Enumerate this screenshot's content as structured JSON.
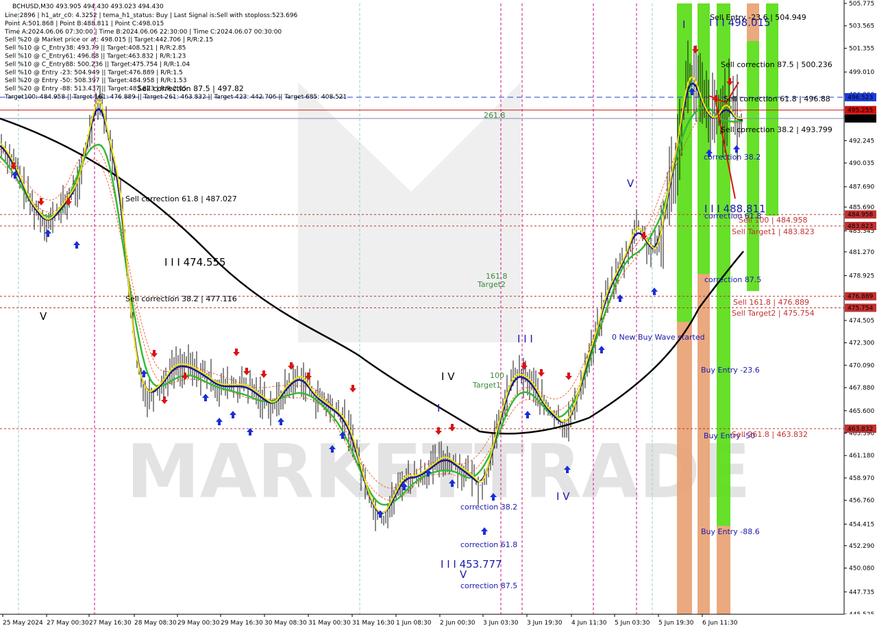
{
  "chart_data": {
    "type": "candlestick",
    "symbol_line": "BCHUSD,M30  493.905 494.430 493.023 494.430",
    "info_lines": [
      "Line:2896 | h1_atr_c0: 4.3252 | tema_h1_status: Buy | Last Signal is:Sell with stoploss:523.696",
      "Point A:501.868 | Point B:488.811 | Point C:498.015",
      "Time A:2024.06.06 07:30:00 | Time B:2024.06.06 22:30:00 | Time C:2024.06.07 00:30:00",
      "Sell %20 @ Market price or at: 498.015 || Target:442.706 | R/R:2.15",
      "Sell %10 @ C_Entry38: 493.79 || Target:408.521 | R/R:2.85",
      "Sell %10 @ C_Entry61: 496.88 || Target:463.832 | R/R:1.23",
      "Sell %10 @ C_Entry88: 500.236 || Target:475.754 | R/R:1.04",
      "Sell %10 @ Entry -23: 504.949 || Target:476.889 | R/R:1.5",
      "Sell %20 @ Entry -50: 508.397 || Target:484.958 | R/R:1.53",
      "Sell %20 @ Entry -88: 513.437 || Target:483.823 | R/R:2.05",
      "Target100: 484.958 || Target 161: 476.889 || Target 261: 463.832 || Target 423: 442.706 || Target 685: 408.521"
    ],
    "y_axis": {
      "ticks": [
        "505.775",
        "503.565",
        "501.355",
        "499.010",
        "496.800",
        "494.590",
        "492.245",
        "490.035",
        "487.690",
        "485.690",
        "483.345",
        "481.270",
        "478.925",
        "476.715",
        "474.505",
        "472.300",
        "470.090",
        "467.880",
        "465.600",
        "463.390",
        "461.180",
        "458.970",
        "456.760",
        "454.415",
        "452.290",
        "450.080",
        "447.735",
        "445.525"
      ],
      "range": [
        445.525,
        505.775
      ]
    },
    "x_axis": {
      "ticks": [
        "25 May 2024",
        "27 May 00:30",
        "27 May 16:30",
        "28 May 08:30",
        "29 May 00:30",
        "29 May 16:30",
        "30 May 08:30",
        "31 May 00:30",
        "31 May 16:30",
        "1 Jun 08:30",
        "2 Jun 00:30",
        "3 Jun 03:30",
        "3 Jun 19:30",
        "4 Jun 11:30",
        "5 Jun 03:30",
        "5 Jun 19:30",
        "6 Jun 11:30"
      ]
    },
    "price_tags": [
      {
        "value": 496.523,
        "label": "496.523",
        "color": "#1a3cdc"
      },
      {
        "value": 495.255,
        "label": "495.255",
        "color": "#d01010"
      },
      {
        "value": 494.43,
        "label": "494.430",
        "color": "#000000"
      },
      {
        "value": 484.958,
        "label": "484.958",
        "color": "#c23030"
      },
      {
        "value": 483.823,
        "label": "483.823",
        "color": "#c23030"
      },
      {
        "value": 476.889,
        "label": "476.889",
        "color": "#c23030"
      },
      {
        "value": 475.754,
        "label": "475.754",
        "color": "#c23030"
      },
      {
        "value": 463.832,
        "label": "463.832",
        "color": "#c23030"
      }
    ],
    "annotations": [
      {
        "text": "Sell Entry -23.6 | 504.949",
        "color": "#000000",
        "cls": "lbl"
      },
      {
        "text": "I I I 498.015",
        "color": "#1a1aa8",
        "cls": "big"
      },
      {
        "text": "I",
        "color": "#1a1aa8",
        "cls": "big"
      },
      {
        "text": "Sell correction 87.5 | 500.236",
        "color": "#000000",
        "cls": "lbl"
      },
      {
        "text": "Sell correction 61.8 | 496.88",
        "color": "#000000",
        "cls": "lbl"
      },
      {
        "text": "Sell correction 38.2 | 493.799",
        "color": "#000000",
        "cls": "lbl"
      },
      {
        "text": "correction 38.2",
        "color": "#1a1aa8",
        "cls": "lbl"
      },
      {
        "text": "V",
        "color": "#1a1aa8",
        "cls": "big"
      },
      {
        "text": "I I I 488.811",
        "color": "#1a1aa8",
        "cls": "big"
      },
      {
        "text": "correction 61.8",
        "color": "#1a1aa8",
        "cls": "lbl"
      },
      {
        "text": "Sell 100 | 484.958",
        "color": "#c23030",
        "cls": "lbl"
      },
      {
        "text": "Sell Target1 | 483.823",
        "color": "#c23030",
        "cls": "lbl"
      },
      {
        "text": "correction 87.5",
        "color": "#1a1aa8",
        "cls": "lbl"
      },
      {
        "text": "Sell 161.8 | 476.889",
        "color": "#c23030",
        "cls": "lbl"
      },
      {
        "text": "Sell Target2 | 475.754",
        "color": "#c23030",
        "cls": "lbl"
      },
      {
        "text": "0 New Buy Wave started",
        "color": "#1a1aa8",
        "cls": "lbl"
      },
      {
        "text": "Buy Entry -23.6",
        "color": "#1a1aa8",
        "cls": "lbl"
      },
      {
        "text": "Buy Entry -50",
        "color": "#1a1aa8",
        "cls": "lbl"
      },
      {
        "text": "Sell 261.8 | 463.832",
        "color": "#c23030",
        "cls": "lbl"
      },
      {
        "text": "Buy Entry -88.6",
        "color": "#1a1aa8",
        "cls": "lbl"
      },
      {
        "text": "261.8",
        "color": "#3a8a3a",
        "cls": "lbl"
      },
      {
        "text": "Sell correction 61.8 | 487.027",
        "color": "#000000",
        "cls": "lbl"
      },
      {
        "text": "I I I 474.555",
        "color": "#000000",
        "cls": "big"
      },
      {
        "text": "Sell correction 38.2 | 477.116",
        "color": "#000000",
        "cls": "lbl"
      },
      {
        "text": "V",
        "color": "#000000",
        "cls": "big"
      },
      {
        "text": "Sell correction 87.5 | 497.82",
        "color": "#000000",
        "cls": "lbl"
      },
      {
        "text": "161.8",
        "color": "#3a8a3a",
        "cls": "lbl"
      },
      {
        "text": "Target2",
        "color": "#3a8a3a",
        "cls": "lbl"
      },
      {
        "text": "I V",
        "color": "#000000",
        "cls": "big"
      },
      {
        "text": "100",
        "color": "#3a8a3a",
        "cls": "lbl"
      },
      {
        "text": "Target1",
        "color": "#3a8a3a",
        "cls": "lbl"
      },
      {
        "text": "I",
        "color": "#1a1aa8",
        "cls": "big"
      },
      {
        "text": "I I I",
        "color": "#1a1aa8",
        "cls": "big"
      },
      {
        "text": "I V",
        "color": "#1a1aa8",
        "cls": "big"
      },
      {
        "text": "correction 38.2",
        "color": "#1a1aa8",
        "cls": "lbl"
      },
      {
        "text": "correction 61.8",
        "color": "#1a1aa8",
        "cls": "lbl"
      },
      {
        "text": "I I I 453.777",
        "color": "#1a1aa8",
        "cls": "big"
      },
      {
        "text": "V",
        "color": "#1a1aa8",
        "cls": "big"
      },
      {
        "text": "correction 87.5",
        "color": "#1a1aa8",
        "cls": "lbl"
      }
    ],
    "watermark": "MARKETTRADE",
    "colors": {
      "ma_black": "#000000",
      "ma_green": "#33bb33",
      "ma_navy": "#1a1a8c",
      "ma_yellow": "#f2e600",
      "envelope": "#ee4411",
      "zone_green": "#55dd11",
      "zone_orange": "#e8a070",
      "session_line": "#cc1188",
      "day_line": "#99cccc"
    }
  }
}
